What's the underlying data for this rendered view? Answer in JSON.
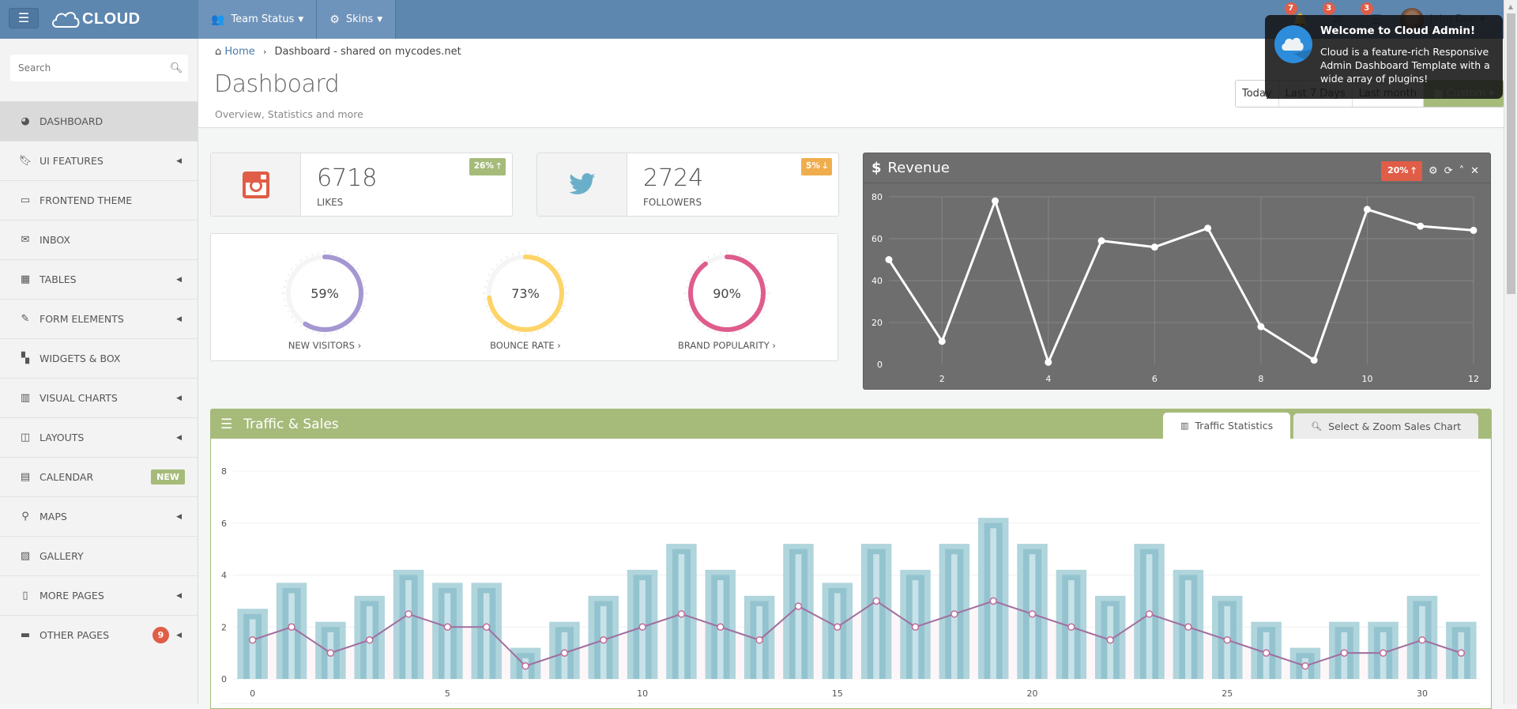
{
  "header": {
    "brand": "CLOUD",
    "nav": [
      {
        "label": "Team Status",
        "icon": "users-icon"
      },
      {
        "label": "Skins",
        "icon": "gear-icon"
      }
    ],
    "notifications": [
      {
        "icon": "bell-icon",
        "count": "7"
      },
      {
        "icon": "envelope-icon",
        "count": "3"
      },
      {
        "icon": "tasks-icon",
        "count": "3"
      }
    ],
    "user": "John Doe"
  },
  "sidebar": {
    "search_placeholder": "Search",
    "items": [
      {
        "label": "DASHBOARD",
        "icon": "dashboard-icon",
        "active": true
      },
      {
        "label": "UI FEATURES",
        "icon": "bookmark-icon",
        "arrow": true
      },
      {
        "label": "FRONTEND THEME",
        "icon": "desktop-icon"
      },
      {
        "label": "INBOX",
        "icon": "envelope-icon"
      },
      {
        "label": "TABLES",
        "icon": "table-icon",
        "arrow": true
      },
      {
        "label": "FORM ELEMENTS",
        "icon": "edit-icon",
        "arrow": true
      },
      {
        "label": "WIDGETS & BOX",
        "icon": "widgets-icon"
      },
      {
        "label": "VISUAL CHARTS",
        "icon": "bar-chart-icon",
        "arrow": true
      },
      {
        "label": "LAYOUTS",
        "icon": "columns-icon",
        "arrow": true
      },
      {
        "label": "CALENDAR",
        "icon": "calendar-icon",
        "badge": "NEW"
      },
      {
        "label": "MAPS",
        "icon": "map-marker-icon",
        "arrow": true
      },
      {
        "label": "GALLERY",
        "icon": "picture-icon"
      },
      {
        "label": "MORE PAGES",
        "icon": "file-icon",
        "arrow": true
      },
      {
        "label": "OTHER PAGES",
        "icon": "briefcase-icon",
        "arrow": true,
        "count": "9"
      }
    ]
  },
  "page": {
    "breadcrumb_home": "Home",
    "breadcrumb_current": "Dashboard - shared on mycodes.net",
    "title": "Dashboard",
    "subtitle": "Overview, Statistics and more",
    "date_range": [
      "Today",
      "Last 7 Days",
      "Last month",
      "Custom"
    ]
  },
  "stats": [
    {
      "value": "6718",
      "label": "LIKES",
      "change": "26%",
      "direction": "up",
      "badge_color": "#a6bb7a",
      "icon": "instagram-icon"
    },
    {
      "value": "2724",
      "label": "FOLLOWERS",
      "change": "5%",
      "direction": "down",
      "badge_color": "#f0ad4e",
      "icon": "twitter-icon"
    }
  ],
  "gauges": [
    {
      "label": "NEW VISITORS",
      "percent": 59,
      "display": "59%",
      "color": "#a597d1"
    },
    {
      "label": "BOUNCE RATE",
      "percent": 73,
      "display": "73%",
      "color": "#fdd468"
    },
    {
      "label": "BRAND POPULARITY",
      "percent": 90,
      "display": "90%",
      "color": "#de5d8c"
    }
  ],
  "revenue": {
    "title": "Revenue",
    "change": "20%",
    "tools": [
      "gear-icon",
      "refresh-icon",
      "collapse-icon",
      "close-icon"
    ]
  },
  "traffic": {
    "title": "Traffic & Sales",
    "tabs": [
      {
        "label": "Traffic Statistics",
        "icon": "bar-chart-icon",
        "active": true
      },
      {
        "label": "Select & Zoom Sales Chart",
        "icon": "zoom-icon",
        "active": false
      }
    ]
  },
  "toast": {
    "title": "Welcome to Cloud Admin!",
    "body": "Cloud is a feature-rich Responsive Admin Dashboard Template with a wide array of plugins!"
  },
  "chart_data": [
    {
      "type": "line",
      "title": "Revenue",
      "x": [
        1,
        2,
        3,
        4,
        5,
        6,
        7,
        8,
        9,
        10,
        11,
        12
      ],
      "values": [
        50,
        11,
        78,
        1,
        59,
        56,
        65,
        18,
        2,
        74,
        66,
        64
      ],
      "xticks": [
        2,
        4,
        6,
        8,
        10,
        12
      ],
      "yticks": [
        0,
        20,
        40,
        60,
        80
      ],
      "ylim": [
        0,
        80
      ],
      "xlim": [
        1,
        12
      ],
      "grid": true
    },
    {
      "type": "bar",
      "title": "Traffic Statistics",
      "x": [
        0,
        1,
        2,
        3,
        4,
        5,
        6,
        7,
        8,
        9,
        10,
        11,
        12,
        13,
        14,
        15,
        16,
        17,
        18,
        19,
        20,
        21,
        22,
        23,
        24,
        25,
        26,
        27,
        28,
        29,
        30,
        31
      ],
      "series": [
        {
          "name": "bars",
          "type": "bar",
          "values": [
            2.7,
            3.7,
            2.2,
            3.2,
            4.2,
            3.7,
            3.7,
            1.2,
            2.2,
            3.2,
            4.2,
            5.2,
            4.2,
            3.2,
            5.2,
            3.7,
            5.2,
            4.2,
            5.2,
            6.2,
            5.2,
            4.2,
            3.2,
            5.2,
            4.2,
            3.2,
            2.2,
            1.2,
            2.2,
            2.2,
            3.2,
            2.2
          ]
        },
        {
          "name": "line",
          "type": "line",
          "values": [
            1.5,
            2,
            1,
            1.5,
            2.5,
            2,
            2,
            0.5,
            1,
            1.5,
            2,
            2.5,
            2,
            1.5,
            2.8,
            2,
            3,
            2,
            2.5,
            3,
            2.5,
            2,
            1.5,
            2.5,
            2,
            1.5,
            1,
            0.5,
            1,
            1,
            1.5,
            1
          ]
        }
      ],
      "xticks": [
        0,
        5,
        10,
        15,
        20,
        25,
        30
      ],
      "yticks": [
        0,
        2,
        4,
        6,
        8
      ],
      "ylim": [
        0,
        8
      ],
      "grid": true
    }
  ]
}
